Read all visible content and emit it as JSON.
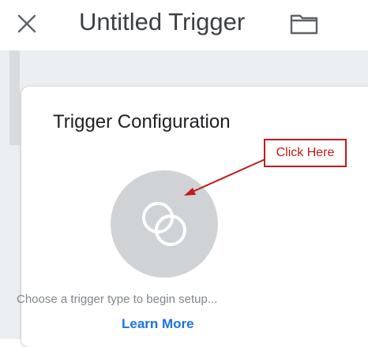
{
  "header": {
    "close_icon": "close-icon",
    "title": "Untitled Trigger",
    "folder_icon": "folder-icon"
  },
  "card": {
    "title": "Trigger Configuration",
    "trigger_icon": "trigger-type-icon",
    "hint": "Choose a trigger type to begin setup...",
    "learn_more": "Learn More"
  },
  "annotation": {
    "callout_text": "Click Here",
    "color": "#c21a1a"
  },
  "colors": {
    "link": "#1a73e8",
    "title_text": "#3c4043",
    "hint_text": "#80868b",
    "circle_fill": "#cfd3d6",
    "backdrop": "#eceff1"
  }
}
